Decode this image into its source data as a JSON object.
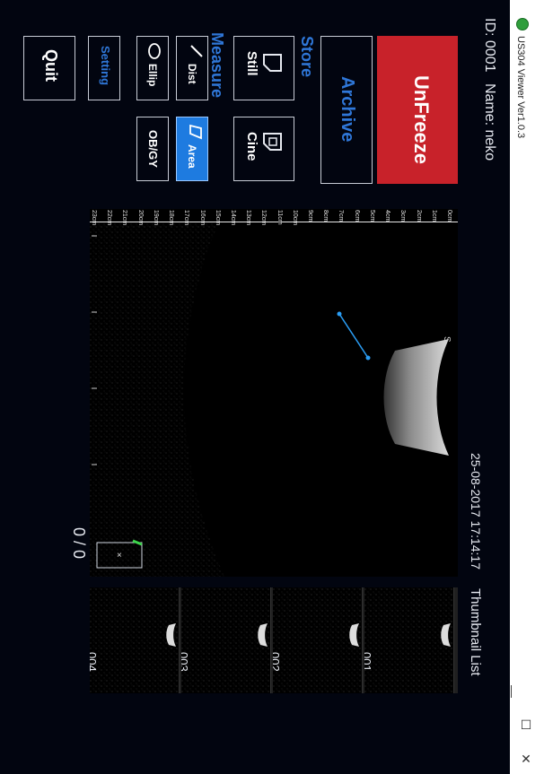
{
  "window": {
    "title": "US304 Viewer Ver1.0.3",
    "minimize": "—",
    "maximize": "☐",
    "close": "✕"
  },
  "patient": {
    "id_label": "ID: 0001",
    "name_label": "Name: neko"
  },
  "buttons": {
    "unfreeze": "UnFreeze",
    "archive": "Archive",
    "store_heading": "Store",
    "still": "Still",
    "cine": "Cine",
    "measure_heading": "Measure",
    "dist": "Dist",
    "area": "Area",
    "ellip": "Ellip",
    "obgy": "OB/GY",
    "setting": "Setting",
    "quit": "Quit"
  },
  "image_view": {
    "timestamp": "25-08-2017 17:14:17",
    "frame_counter": "0 / 0",
    "probe_marker": "S",
    "depth_ticks": [
      "0cm",
      "1cm",
      "2cm",
      "3cm",
      "4cm",
      "5cm",
      "6cm",
      "7cm",
      "8cm",
      "9cm",
      "10cm",
      "11cm",
      "12cm",
      "13cm",
      "14cm",
      "15cm",
      "16cm",
      "17cm",
      "18cm",
      "19cm",
      "20cm",
      "21cm",
      "22cm",
      "23cm"
    ]
  },
  "thumbnails": {
    "heading": "Thumbnail List",
    "items": [
      "001",
      "002",
      "003",
      "004"
    ]
  },
  "colors": {
    "background": "#020510",
    "unfreeze": "#c8222a",
    "accent_blue": "#2f77d8",
    "area_active": "#1e7be0",
    "measure_line": "#2a9df4"
  }
}
